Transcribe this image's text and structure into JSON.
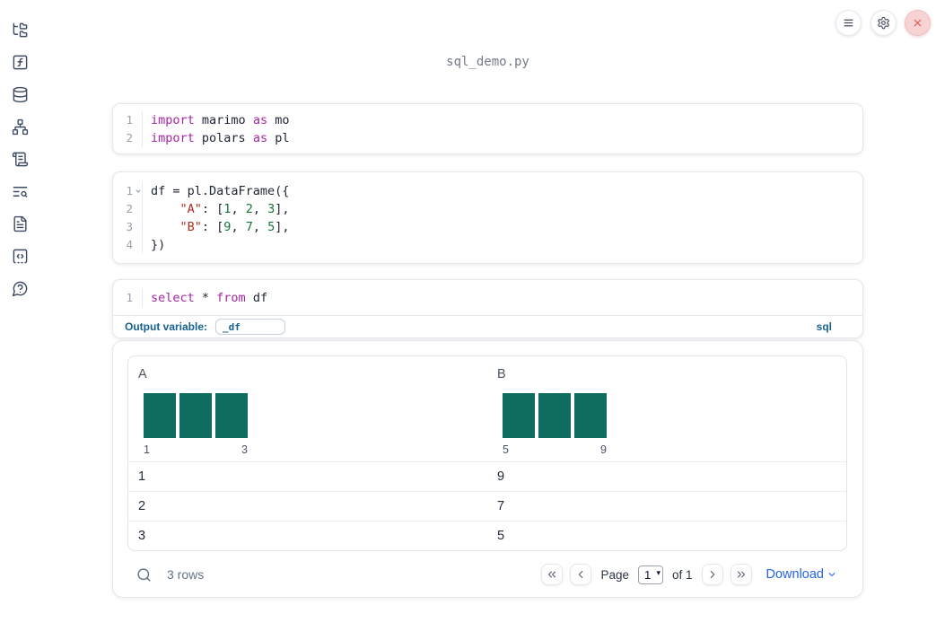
{
  "window": {
    "title": "sql_demo.py"
  },
  "sidebar": {
    "icons": [
      "file-tree-icon",
      "function-square-icon",
      "database-icon",
      "dependency-graph-icon",
      "scroll-icon",
      "logs-search-icon",
      "document-icon",
      "snippets-icon",
      "help-icon"
    ]
  },
  "topbar": {
    "icons": [
      "menu-icon",
      "settings-gear-icon",
      "close-icon"
    ]
  },
  "cells": [
    {
      "name": "imports-cell",
      "lines": [
        {
          "num": "1",
          "fold": false,
          "tokens": [
            [
              "kw",
              "import"
            ],
            [
              "def",
              " marimo "
            ],
            [
              "kw",
              "as"
            ],
            [
              "def",
              " mo"
            ]
          ]
        },
        {
          "num": "2",
          "fold": false,
          "tokens": [
            [
              "kw",
              "import"
            ],
            [
              "def",
              " polars "
            ],
            [
              "kw",
              "as"
            ],
            [
              "def",
              " pl"
            ]
          ]
        }
      ]
    },
    {
      "name": "dataframe-cell",
      "lines": [
        {
          "num": "1",
          "fold": true,
          "tokens": [
            [
              "def",
              "df = pl.DataFrame({"
            ]
          ]
        },
        {
          "num": "2",
          "fold": false,
          "tokens": [
            [
              "def",
              "    "
            ],
            [
              "str",
              "\"A\""
            ],
            [
              "def",
              ": ["
            ],
            [
              "num",
              "1"
            ],
            [
              "def",
              ", "
            ],
            [
              "num",
              "2"
            ],
            [
              "def",
              ", "
            ],
            [
              "num",
              "3"
            ],
            [
              "def",
              "],"
            ]
          ]
        },
        {
          "num": "3",
          "fold": false,
          "tokens": [
            [
              "def",
              "    "
            ],
            [
              "str",
              "\"B\""
            ],
            [
              "def",
              ": ["
            ],
            [
              "num",
              "9"
            ],
            [
              "def",
              ", "
            ],
            [
              "num",
              "7"
            ],
            [
              "def",
              ", "
            ],
            [
              "num",
              "5"
            ],
            [
              "def",
              "],"
            ]
          ]
        },
        {
          "num": "4",
          "fold": false,
          "tokens": [
            [
              "def",
              "})"
            ]
          ]
        }
      ]
    },
    {
      "name": "sql-cell",
      "lines": [
        {
          "num": "1",
          "fold": false,
          "tokens": [
            [
              "kw",
              "select"
            ],
            [
              "def",
              " * "
            ],
            [
              "kw",
              "from"
            ],
            [
              "def",
              " df"
            ]
          ]
        }
      ]
    }
  ],
  "sql_cell": {
    "output_variable_label": "Output variable:",
    "output_variable_value": "_df",
    "language_label": "sql"
  },
  "table": {
    "columns": [
      {
        "label": "A",
        "hist": {
          "bar_heights": [
            1,
            1,
            1
          ],
          "min_label": "1",
          "max_label": "3"
        }
      },
      {
        "label": "B",
        "hist": {
          "bar_heights": [
            1,
            1,
            1
          ],
          "min_label": "5",
          "max_label": "9"
        }
      }
    ],
    "rows": [
      [
        "1",
        "9"
      ],
      [
        "2",
        "7"
      ],
      [
        "3",
        "5"
      ]
    ],
    "footer": {
      "row_count_label": "3 rows",
      "page_label": "Page",
      "page_value": "1",
      "of_label": "of 1",
      "download_label": "Download"
    }
  },
  "colors": {
    "keyword": "#a626a4",
    "string": "#b02c22",
    "number": "#177235",
    "code_default": "#1c2434",
    "accent_blue": "#17618f",
    "link_blue": "#2563eb",
    "histogram_bar": "#0e6d5e",
    "close_red": "#d95757"
  }
}
